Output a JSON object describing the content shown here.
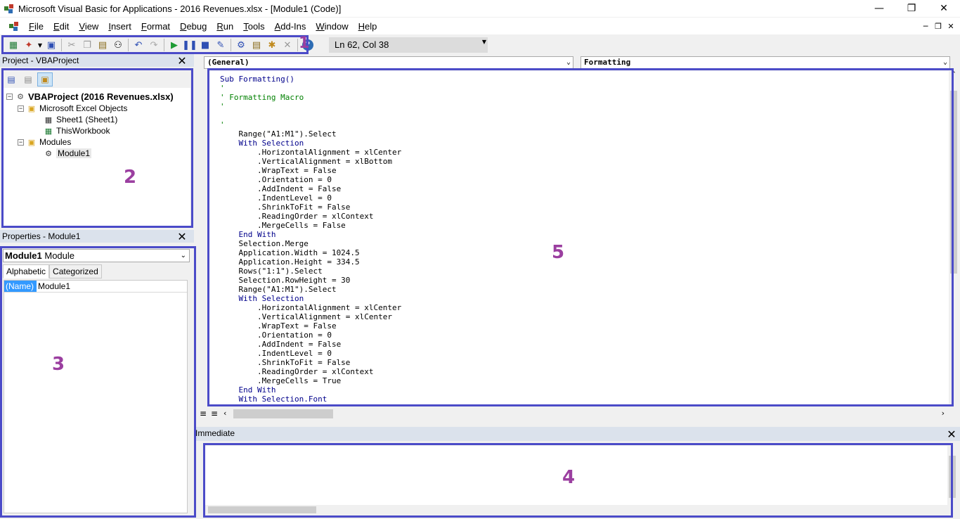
{
  "window": {
    "title": "Microsoft Visual Basic for Applications - 2016 Revenues.xlsx - [Module1 (Code)]",
    "controls": [
      "minimize-icon",
      "restore-icon",
      "close-icon"
    ]
  },
  "menu": {
    "items": [
      "File",
      "Edit",
      "View",
      "Insert",
      "Format",
      "Debug",
      "Run",
      "Tools",
      "Add-Ins",
      "Window",
      "Help"
    ]
  },
  "toolbar": {
    "status": "Ln 62, Col 38"
  },
  "project": {
    "title": "Project - VBAProject",
    "root": "VBAProject (2016 Revenues.xlsx)",
    "excel_objects_folder": "Microsoft Excel Objects",
    "sheet1": "Sheet1 (Sheet1)",
    "workbook": "ThisWorkbook",
    "modules_folder": "Modules",
    "module1": "Module1"
  },
  "properties": {
    "title": "Properties - Module1",
    "object_name": "Module1",
    "object_type": "Module",
    "tabs": [
      "Alphabetic",
      "Categorized"
    ],
    "rows": [
      {
        "name": "(Name)",
        "value": "Module1"
      }
    ]
  },
  "code": {
    "object_combo": "(General)",
    "proc_combo": "Formatting",
    "lines": [
      {
        "t": "Sub Formatting()",
        "c": "kw"
      },
      {
        "t": "'",
        "c": "cm"
      },
      {
        "t": "' Formatting Macro",
        "c": "cm"
      },
      {
        "t": "'",
        "c": "cm"
      },
      {
        "t": "",
        "c": ""
      },
      {
        "t": "'",
        "c": "cm"
      },
      {
        "t": "    Range(\"A1:M1\").Select",
        "c": ""
      },
      {
        "t": "    With Selection",
        "c": "kw"
      },
      {
        "t": "        .HorizontalAlignment = xlCenter",
        "c": ""
      },
      {
        "t": "        .VerticalAlignment = xlBottom",
        "c": ""
      },
      {
        "t": "        .WrapText = False",
        "c": ""
      },
      {
        "t": "        .Orientation = 0",
        "c": ""
      },
      {
        "t": "        .AddIndent = False",
        "c": ""
      },
      {
        "t": "        .IndentLevel = 0",
        "c": ""
      },
      {
        "t": "        .ShrinkToFit = False",
        "c": ""
      },
      {
        "t": "        .ReadingOrder = xlContext",
        "c": ""
      },
      {
        "t": "        .MergeCells = False",
        "c": ""
      },
      {
        "t": "    End With",
        "c": "kw"
      },
      {
        "t": "    Selection.Merge",
        "c": ""
      },
      {
        "t": "    Application.Width = 1024.5",
        "c": ""
      },
      {
        "t": "    Application.Height = 334.5",
        "c": ""
      },
      {
        "t": "    Rows(\"1:1\").Select",
        "c": ""
      },
      {
        "t": "    Selection.RowHeight = 30",
        "c": ""
      },
      {
        "t": "    Range(\"A1:M1\").Select",
        "c": ""
      },
      {
        "t": "    With Selection",
        "c": "kw"
      },
      {
        "t": "        .HorizontalAlignment = xlCenter",
        "c": ""
      },
      {
        "t": "        .VerticalAlignment = xlCenter",
        "c": ""
      },
      {
        "t": "        .WrapText = False",
        "c": ""
      },
      {
        "t": "        .Orientation = 0",
        "c": ""
      },
      {
        "t": "        .AddIndent = False",
        "c": ""
      },
      {
        "t": "        .IndentLevel = 0",
        "c": ""
      },
      {
        "t": "        .ShrinkToFit = False",
        "c": ""
      },
      {
        "t": "        .ReadingOrder = xlContext",
        "c": ""
      },
      {
        "t": "        .MergeCells = True",
        "c": ""
      },
      {
        "t": "    End With",
        "c": "kw"
      },
      {
        "t": "    With Selection.Font",
        "c": "kw"
      }
    ]
  },
  "immediate": {
    "title": "Immediate"
  },
  "annotations": {
    "numbers": [
      "1",
      "2",
      "3",
      "4",
      "5"
    ],
    "box_color": "#4b4bc8",
    "number_color": "#9b3fa0"
  }
}
